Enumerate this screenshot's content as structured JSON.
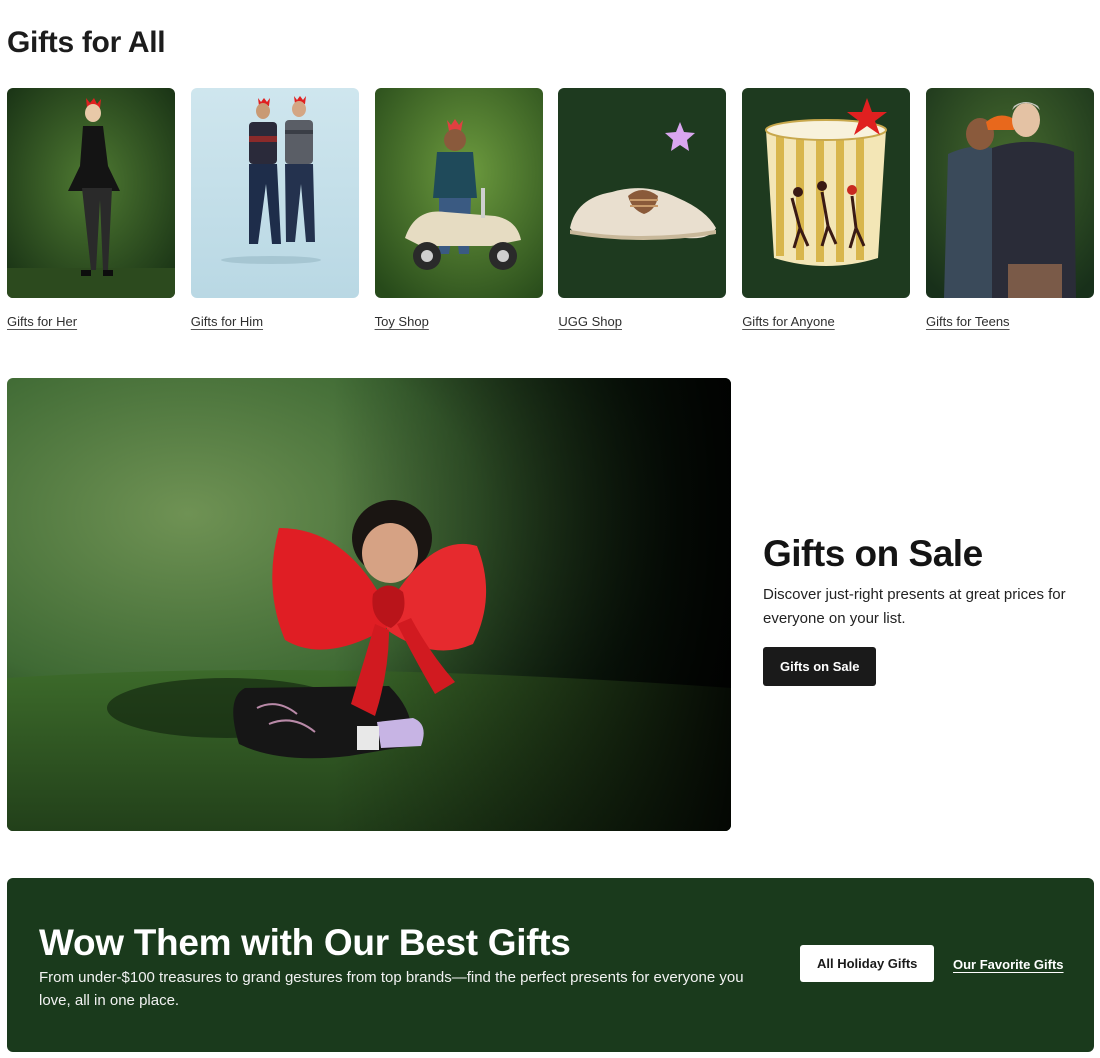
{
  "section": {
    "title": "Gifts for All"
  },
  "categories": [
    {
      "label": "Gifts for Her"
    },
    {
      "label": "Gifts for Him"
    },
    {
      "label": "Toy Shop"
    },
    {
      "label": "UGG Shop"
    },
    {
      "label": "Gifts for Anyone"
    },
    {
      "label": "Gifts for Teens"
    }
  ],
  "promo": {
    "title": "Gifts on Sale",
    "text": "Discover just-right presents at great prices for everyone on your list.",
    "button_label": "Gifts on Sale"
  },
  "banner": {
    "title": "Wow Them with Our Best Gifts",
    "text": "From under-$100 treasures to grand gestures from top brands—find the perfect presents for everyone you love, all in one place.",
    "button_label": "All Holiday Gifts",
    "link_label": "Our Favorite Gifts"
  },
  "colors": {
    "banner_bg": "#1a3a1c",
    "tile_dark_green": "#1e3a1f",
    "accent_red": "#e02020",
    "accent_lilac": "#d9a6ef"
  }
}
